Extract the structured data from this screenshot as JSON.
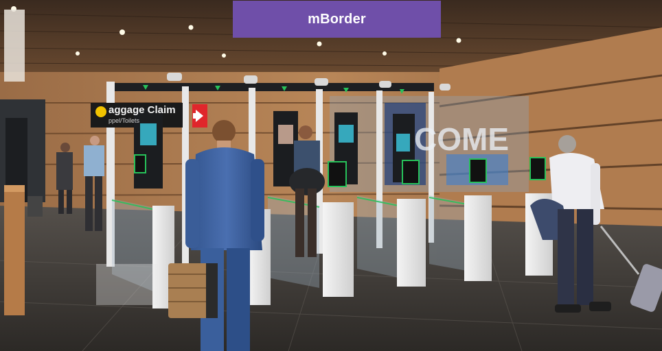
{
  "banner": {
    "title": "mBorder",
    "color": "#6f4fa9"
  },
  "signage": {
    "main": "aggage Claim",
    "sub": "ppel/Toilets"
  },
  "wall_graphic": {
    "text": "COME"
  },
  "colors": {
    "gate_accent": "#27c25a",
    "wall_wood": "#a8784f",
    "floor": "#3b3835"
  }
}
